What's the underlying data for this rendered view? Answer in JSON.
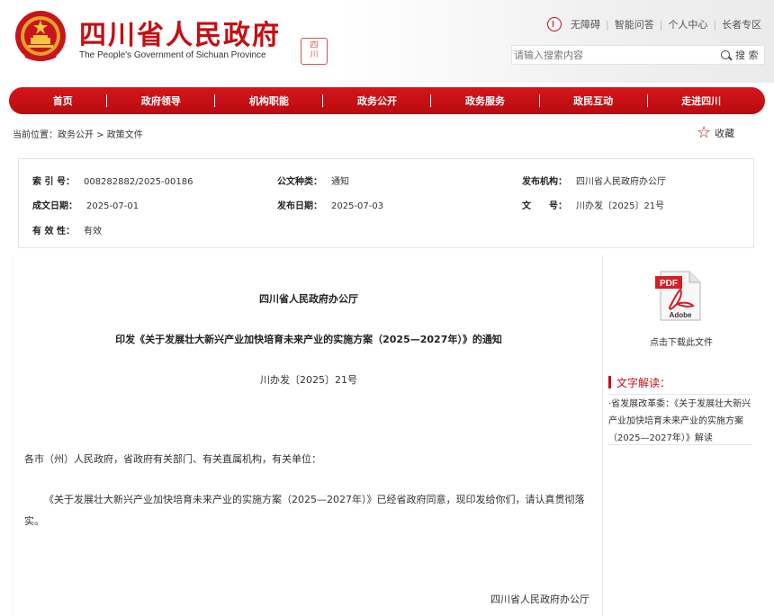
{
  "header": {
    "title": "四川省人民政府",
    "subtitle": "The People's Government of Sichuan Province",
    "seal_text": "四川",
    "links": [
      "无障碍",
      "智能问答",
      "个人中心",
      "长者专区"
    ],
    "search_placeholder": "请输入搜索内容",
    "search_button": "搜 索"
  },
  "nav": {
    "items": [
      "首页",
      "政府领导",
      "机构职能",
      "政务公开",
      "政务服务",
      "政民互动",
      "走进四川"
    ]
  },
  "breadcrumb": {
    "text": "当前位置：政务公开 > 政策文件",
    "favorite": "收藏"
  },
  "meta": {
    "index_no_label": "索 引 号：",
    "index_no": "008282882/2025-00186",
    "doc_type_label": "公文种类：",
    "doc_type": "通知",
    "publisher_label": "发布机构：",
    "publisher": "四川省人民政府办公厅",
    "created_label": "成文日期：",
    "created": "2025-07-01",
    "published_label": "发布日期：",
    "published": "2025-07-03",
    "doc_no_label": "文　　号：",
    "doc_no": "川办发〔2025〕21号",
    "validity_label": "有 效 性：",
    "validity": "有效"
  },
  "article": {
    "issuer": "四川省人民政府办公厅",
    "title": "印发《关于发展壮大新兴产业加快培育未来产业的实施方案（2025—2027年）》的通知",
    "doc_no": "川办发〔2025〕21号",
    "addressee": "各市（州）人民政府，省政府有关部门、有关直属机构，有关单位：",
    "body": "《关于发展壮大新兴产业加快培育未来产业的实施方案（2025—2027年）》已经省政府同意，现印发给你们，请认真贯彻落实。",
    "signature": "四川省人民政府办公厅"
  },
  "sidebar": {
    "pdf_label": "PDF",
    "adobe_label": "Adobe",
    "download": "点击下载此文件",
    "interp_heading": "文字解读：",
    "interp_link": "·省发展改革委：《关于发展壮大新兴产业加快培育未来产业的实施方案（2025—2027年）》解读"
  },
  "colors": {
    "brand_red": "#c40f14",
    "nav_red": "#d7151b"
  }
}
